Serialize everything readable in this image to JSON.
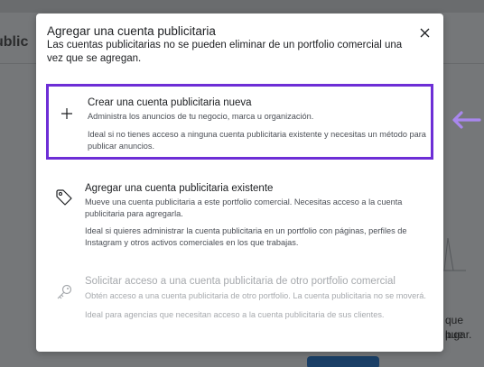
{
  "background": {
    "page_title_fragment": "ublic",
    "right_text_line1": "que pue",
    "right_text_line2": "lugar."
  },
  "dialog": {
    "title": "Agregar una cuenta publicitaria",
    "subtitle": "Las cuentas publicitarias no se pueden eliminar de un portfolio comercial una vez que se agregan.",
    "close_icon": "close-icon"
  },
  "options": [
    {
      "icon": "plus-icon",
      "title": "Crear una cuenta publicitaria nueva",
      "description": "Administra los anuncios de tu negocio, marca u organización.",
      "note": "Ideal si no tienes acceso a ninguna cuenta publicitaria existente y necesitas un método para publicar anuncios.",
      "highlight_color": "#6d2ed6"
    },
    {
      "icon": "tag-icon",
      "title": "Agregar una cuenta publicitaria existente",
      "description": "Mueve una cuenta publicitaria a este portfolio comercial. Necesitas acceso a la cuenta publicitaria para agregarla.",
      "note": "Ideal si quieres administrar la cuenta publicitaria en un portfolio con páginas, perfiles de Instagram y otros activos comerciales en los que trabajas."
    },
    {
      "icon": "key-icon",
      "title": "Solicitar acceso a una cuenta publicitaria de otro portfolio comercial",
      "description": "Obtén acceso a una cuenta publicitaria de otro portfolio. La cuenta publicitaria no se moverá.",
      "note": "Ideal para agencias que necesitan acceso a la cuenta publicitaria de sus clientes.",
      "disabled": true
    }
  ],
  "annotation": {
    "icon": "arrow-left-icon",
    "color": "#a987ee"
  }
}
